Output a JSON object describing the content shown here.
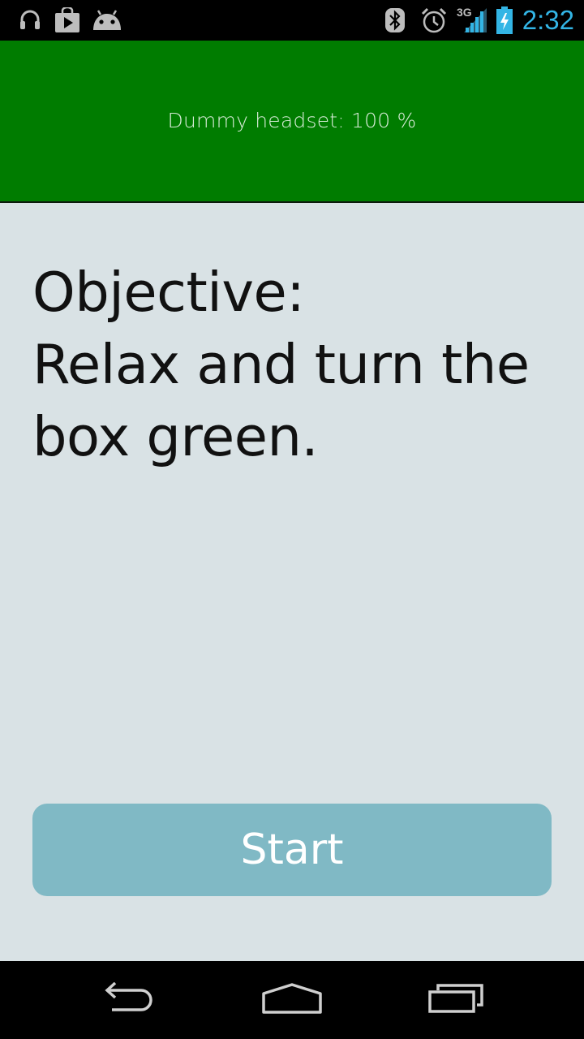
{
  "status_bar": {
    "time": "2:32",
    "network": "3G",
    "accent_color": "#33b5e5",
    "left_icons": [
      "headphones-icon",
      "play-store-icon",
      "android-icon"
    ],
    "right_icons": [
      "bluetooth-icon",
      "alarm-icon",
      "signal-icon",
      "battery-charging-icon"
    ]
  },
  "header": {
    "headset_status": "Dummy headset: 100 %",
    "background_color": "#007c00"
  },
  "main": {
    "objective_line1": "Objective:",
    "objective_line2": "Relax and turn the",
    "objective_line3": "box green.",
    "background_color": "#d9e2e5"
  },
  "start_button": {
    "label": "Start",
    "color": "#80b9c5"
  },
  "nav_bar": {
    "icons": [
      "back-icon",
      "home-icon",
      "recent-apps-icon"
    ]
  }
}
